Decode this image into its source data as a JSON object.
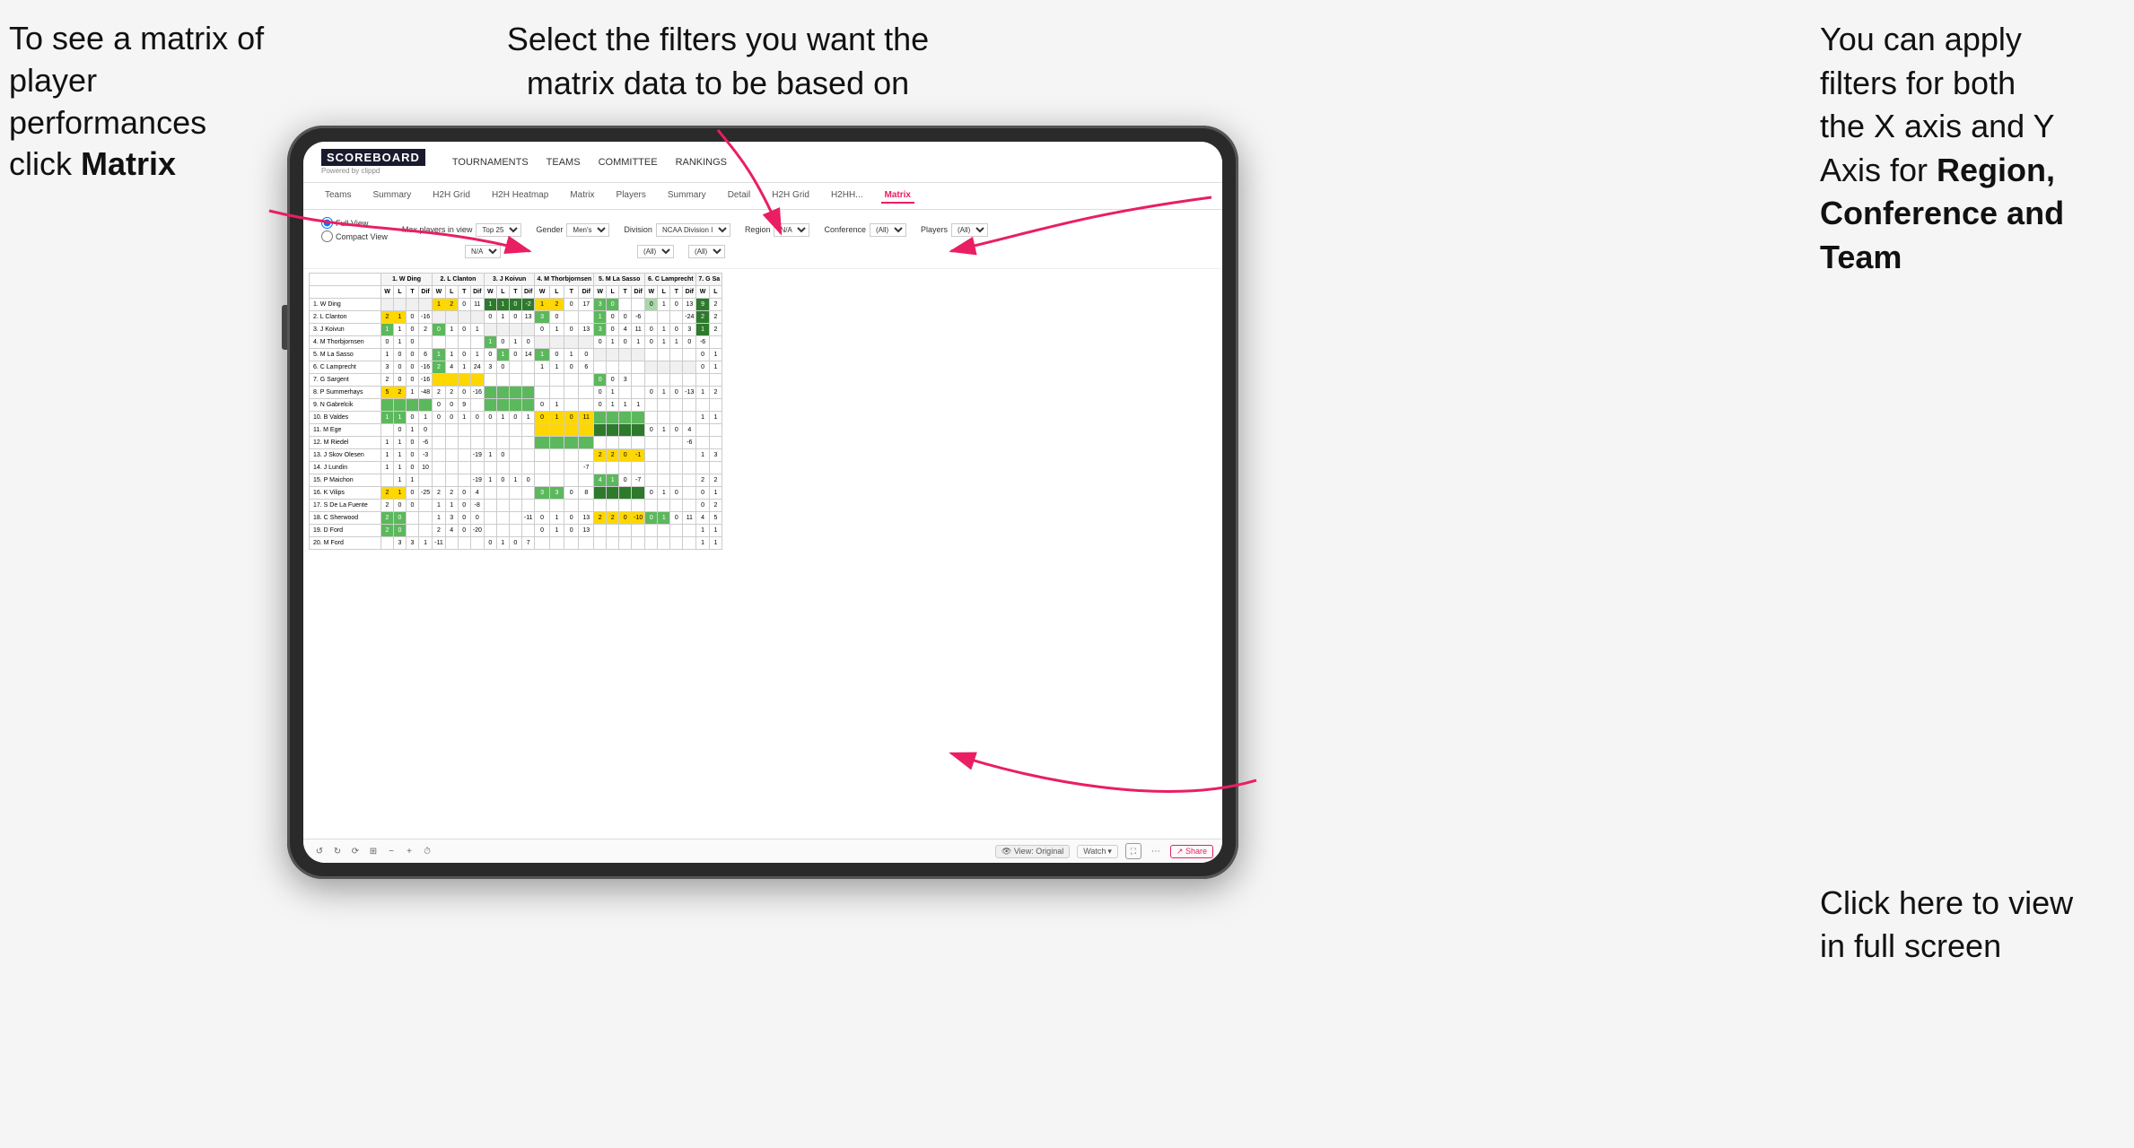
{
  "annotations": {
    "topleft": {
      "line1": "To see a matrix of",
      "line2": "player performances",
      "line3_normal": "click ",
      "line3_bold": "Matrix"
    },
    "topcenter": {
      "text": "Select the filters you want the\nmatrix data to be based on"
    },
    "topright": {
      "line1": "You  can apply",
      "line2": "filters for both",
      "line3": "the X axis and Y",
      "line4_normal": "Axis for ",
      "line4_bold": "Region,",
      "line5": "Conference and",
      "line6": "Team"
    },
    "bottomright": {
      "line1": "Click here to view",
      "line2": "in full screen"
    }
  },
  "nav": {
    "logo_top": "SCOREBOARD",
    "logo_bottom": "Powered by clippd",
    "items": [
      "TOURNAMENTS",
      "TEAMS",
      "COMMITTEE",
      "RANKINGS"
    ]
  },
  "subnav": {
    "items": [
      "Teams",
      "Summary",
      "H2H Grid",
      "H2H Heatmap",
      "Matrix",
      "Players",
      "Summary",
      "Detail",
      "H2H Grid",
      "H2HH...",
      "Matrix"
    ],
    "active_index": 10
  },
  "filters": {
    "view_options": [
      "Full View",
      "Compact View"
    ],
    "max_players_label": "Max players in view",
    "max_players_value": "Top 25",
    "gender_label": "Gender",
    "gender_value": "Men's",
    "division_label": "Division",
    "division_value": "NCAA Division I",
    "region_label": "Region",
    "region_value1": "N/A",
    "region_value2": "N/A",
    "conference_label": "Conference",
    "conference_value1": "(All)",
    "conference_value2": "(All)",
    "players_label": "Players",
    "players_value1": "(All)",
    "players_value2": "(All)"
  },
  "matrix": {
    "col_headers": [
      "1. W Ding",
      "2. L Clanton",
      "3. J Koivun",
      "4. M Thorbjornsen",
      "5. M La Sasso",
      "6. C Lamprecht",
      "7. G Sa"
    ],
    "col_subheaders": [
      "W",
      "L",
      "T",
      "Dif"
    ],
    "rows": [
      {
        "name": "1. W Ding",
        "data": "header"
      },
      {
        "name": "2. L Clanton",
        "data": "row"
      },
      {
        "name": "3. J Koivun",
        "data": "row"
      },
      {
        "name": "4. M Thorbjornsen",
        "data": "row"
      },
      {
        "name": "5. M La Sasso",
        "data": "row"
      },
      {
        "name": "6. C Lamprecht",
        "data": "row"
      },
      {
        "name": "7. G Sargent",
        "data": "row"
      },
      {
        "name": "8. P Summerhays",
        "data": "row"
      },
      {
        "name": "9. N Gabrelcik",
        "data": "row"
      },
      {
        "name": "10. B Valdes",
        "data": "row"
      },
      {
        "name": "11. M Ege",
        "data": "row"
      },
      {
        "name": "12. M Riedel",
        "data": "row"
      },
      {
        "name": "13. J Skov Olesen",
        "data": "row"
      },
      {
        "name": "14. J Lundin",
        "data": "row"
      },
      {
        "name": "15. P Maichon",
        "data": "row"
      },
      {
        "name": "16. K Vilips",
        "data": "row"
      },
      {
        "name": "17. S De La Fuente",
        "data": "row"
      },
      {
        "name": "18. C Sherwood",
        "data": "row"
      },
      {
        "name": "19. D Ford",
        "data": "row"
      },
      {
        "name": "20. M Ford",
        "data": "row"
      }
    ]
  },
  "bottom_bar": {
    "view_label": "View: Original",
    "watch_label": "Watch",
    "share_label": "Share"
  }
}
